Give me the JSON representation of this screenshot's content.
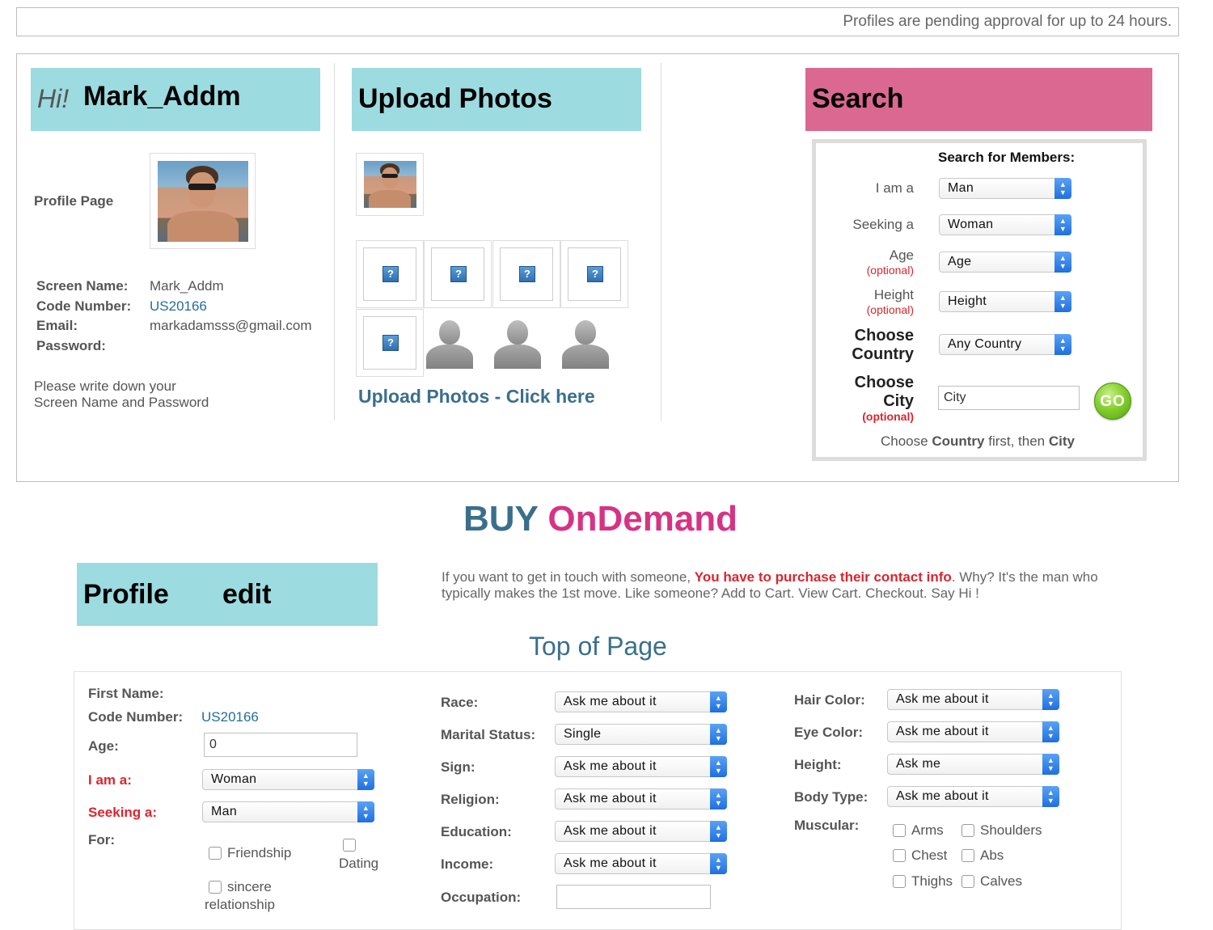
{
  "notice": "Profiles are pending approval for up to 24 hours.",
  "profile_card": {
    "greeting": "Hi!",
    "username": "Mark_Addm",
    "profile_page_label": "Profile Page",
    "fields": [
      {
        "label": "Screen Name:",
        "value": "Mark_Addm"
      },
      {
        "label": "Code Number:",
        "value": "US20166"
      },
      {
        "label": "Email:",
        "value": "markadamsss@gmail.com"
      },
      {
        "label": "Password:",
        "value": ""
      }
    ],
    "note_line1": "Please write down your",
    "note_line2": "Screen Name and Password"
  },
  "upload": {
    "title": "Upload Photos",
    "link": "Upload Photos - Click here"
  },
  "search": {
    "title": "Search",
    "heading": "Search for Members:",
    "i_am_label": "I am a",
    "i_am_value": "Man",
    "seeking_label": "Seeking a",
    "seeking_value": "Woman",
    "age_label": "Age",
    "age_value": "Age",
    "height_label": "Height",
    "height_value": "Height",
    "optional": "(optional)",
    "choose_country_1": "Choose",
    "choose_country_2": "Country",
    "country_value": "Any Country",
    "choose_city_1": "Choose",
    "choose_city_2": "City",
    "city_placeholder": "City",
    "go_label": "GO",
    "hint_pre": "Choose ",
    "hint_country": "Country",
    "hint_mid": " first, then ",
    "hint_city": "City"
  },
  "buy": {
    "part1": "BUY",
    "part2": "OnDemand"
  },
  "profile_edit": {
    "title_1": "Profile",
    "title_2": "edit"
  },
  "info": {
    "pre": "If you want to get in touch with someone, ",
    "highlight": "You have to purchase their contact info",
    "post": ". Why? It's the man who",
    "line2": "typically makes the 1st move. Like someone? Add to Cart. View Cart. Checkout. Say Hi !"
  },
  "top_of_page": "Top of Page",
  "form": {
    "first_name_label": "First Name:",
    "code_label": "Code Number:",
    "code_value": "US20166",
    "age_label": "Age:",
    "age_value": "0",
    "i_am_label": "I am a:",
    "i_am_value": "Woman",
    "seeking_label": "Seeking a:",
    "seeking_value": "Man",
    "for_label": "For:",
    "for_options": {
      "friendship": "Friendship",
      "dating": "Dating",
      "sincere_1": "sincere",
      "sincere_2": "relationship"
    },
    "race_label": "Race:",
    "race_value": "Ask me about it",
    "marital_label": "Marital Status:",
    "marital_value": "Single",
    "sign_label": "Sign:",
    "sign_value": "Ask me about it",
    "religion_label": "Religion:",
    "religion_value": "Ask me about it",
    "education_label": "Education:",
    "education_value": "Ask me about it",
    "income_label": "Income:",
    "income_value": "Ask me about it",
    "occupation_label": "Occupation:",
    "hair_label": "Hair Color:",
    "hair_value": "Ask me about it",
    "eye_label": "Eye Color:",
    "eye_value": "Ask me about it",
    "height_label": "Height:",
    "height_value": "Ask me",
    "body_label": "Body Type:",
    "body_value": "Ask me about it",
    "muscular_label": "Muscular:",
    "muscular_options": {
      "arms": "Arms",
      "shoulders": "Shoulders",
      "chest": "Chest",
      "abs": "Abs",
      "thighs": "Thighs",
      "calves": "Calves"
    }
  },
  "colors": {
    "cyan": "#9cdbe0",
    "pink": "#db6890",
    "teal_text": "#3a6f8c",
    "magenta_text": "#d63384",
    "red": "#d8262f",
    "link_blue": "#236f9a"
  }
}
